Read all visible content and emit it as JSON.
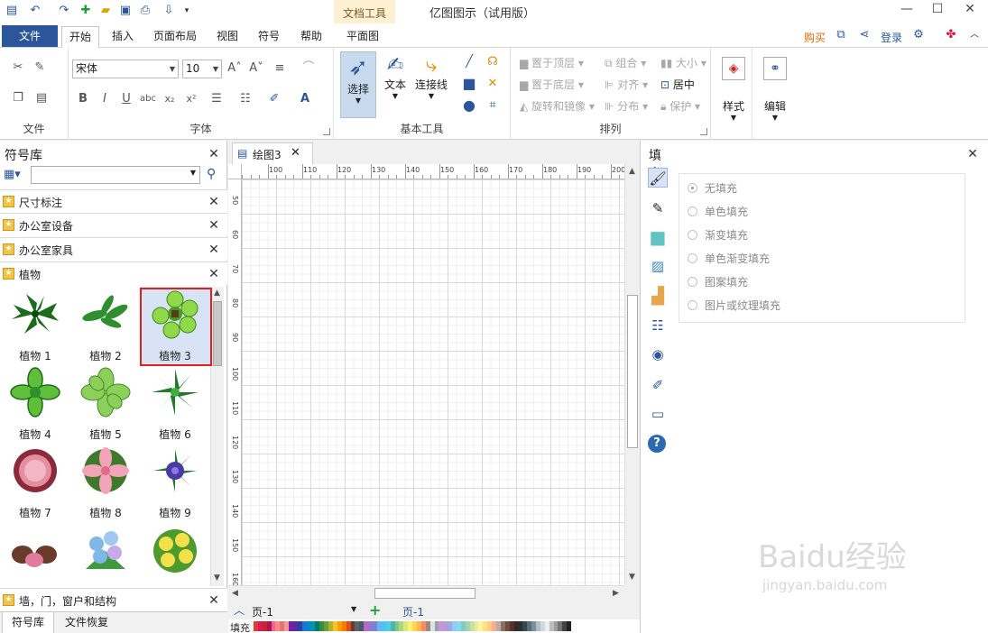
{
  "app": {
    "title": "亿图图示（试用版）",
    "doc_tools": "文档工具"
  },
  "menu": {
    "file": "文件",
    "tabs": [
      "开始",
      "插入",
      "页面布局",
      "视图",
      "符号",
      "帮助",
      "平面图"
    ],
    "buy": "购买",
    "login": "登录"
  },
  "ribbon": {
    "file_group": "文件",
    "font": {
      "name": "宋体",
      "size": "10",
      "group": "字体"
    },
    "basic_tools": {
      "select": "选择",
      "text": "文本",
      "connector": "连接线",
      "group": "基本工具"
    },
    "arrange": {
      "bring_front": "置于顶层",
      "send_back": "置于底层",
      "rotate_mirror": "旋转和镜像",
      "group_btn": "组合",
      "align": "对齐",
      "distribute": "分布",
      "size": "大小",
      "center": "居中",
      "protect": "保护",
      "group": "排列"
    },
    "style": "样式",
    "edit": "编辑"
  },
  "library": {
    "title": "符号库",
    "categories": [
      "尺寸标注",
      "办公室设备",
      "办公室家具",
      "植物"
    ],
    "bottom_category": "墙，门，窗户和结构",
    "shapes": [
      "植物 1",
      "植物 2",
      "植物 3",
      "植物 4",
      "植物 5",
      "植物 6",
      "植物 7",
      "植物 8",
      "植物 9"
    ],
    "tabs": [
      "符号库",
      "文件恢复"
    ]
  },
  "document": {
    "tab": "绘图3",
    "hruler": [
      "100",
      "110",
      "120",
      "130",
      "140",
      "150",
      "160",
      "170",
      "180",
      "190",
      "200"
    ],
    "vruler": [
      "50",
      "60",
      "70",
      "80",
      "90",
      "100",
      "110",
      "120",
      "130",
      "140",
      "150",
      "160"
    ],
    "page_left": "页-1",
    "page_tab": "页-1",
    "fill_label": "填充"
  },
  "fill_panel": {
    "title": "填充",
    "options": [
      "无填充",
      "单色填充",
      "渐变填充",
      "单色渐变填充",
      "图案填充",
      "图片或纹理填充"
    ],
    "selected": 0
  },
  "watermark": {
    "brand": "Baidu经验",
    "url": "jingyan.baidu.com"
  },
  "colors": {
    "accent": "#2b579a",
    "selection_box": "#e02020",
    "buy": "#e06a00"
  },
  "icons": [
    "app-logo-icon",
    "undo-icon",
    "redo-icon",
    "new-icon",
    "open-icon",
    "save-icon",
    "print-icon",
    "export-icon",
    "share-icon",
    "settings-icon",
    "help-icon"
  ]
}
